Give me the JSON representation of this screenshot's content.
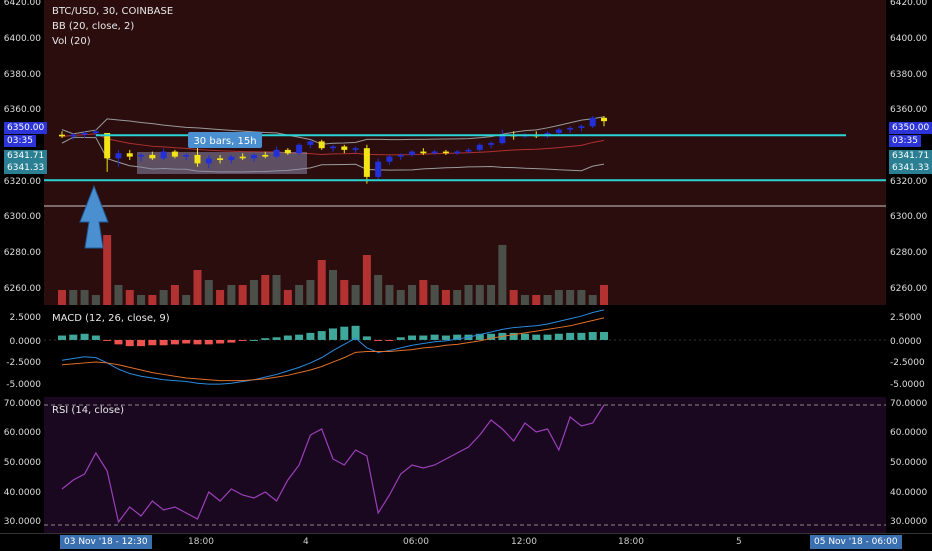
{
  "symbol_title": "BTC/USD, 30, COINBASE",
  "indicators": {
    "bb": "BB (20, close, 2)",
    "vol": "Vol (20)",
    "macd": "MACD (12, 26, close, 9)",
    "rsi": "RSI (14, close)"
  },
  "price_axis": {
    "ticks": [
      "6420.00",
      "6400.00",
      "6380.00",
      "6360.00",
      "6320.00",
      "6300.00",
      "6280.00",
      "6260.00"
    ],
    "labels": {
      "last": "6350.00",
      "countdown": "03:35",
      "line_high": "6341.71",
      "line_low": "6341.33"
    }
  },
  "macd_axis": {
    "ticks": [
      "2.5000",
      "0.0000",
      "-2.5000",
      "-5.0000"
    ]
  },
  "rsi_axis": {
    "ticks": [
      "70.0000",
      "60.0000",
      "50.0000",
      "40.0000",
      "30.0000"
    ]
  },
  "time_axis": {
    "start_box": "03 Nov '18 - 12:30",
    "ticks": [
      "18:00",
      "4",
      "06:00",
      "12:00",
      "18:00",
      "5"
    ],
    "end_box": "05 Nov '18 - 06:00"
  },
  "measure_label": "30 bars, 15h",
  "colors": {
    "up_candle": "#2130d8",
    "down_candle": "#f2e416",
    "horizontal_lines": "#2ad3d6",
    "bollinger": "#9a9a9a",
    "vol_up": "#4a4f4a",
    "vol_down": "#b23232",
    "macd_line": "#2a8be0",
    "signal_line": "#e0702a",
    "hist_pos": "#3fa89a",
    "hist_neg": "#ef5350",
    "rsi_line": "#9b3fb8",
    "arrow": "#4a8fd0"
  },
  "chart_data": [
    {
      "type": "candlestick",
      "title": "BTC/USD, 30, COINBASE",
      "candles": [
        {
          "o": 6342,
          "h": 6344,
          "l": 6340,
          "c": 6341
        },
        {
          "o": 6341,
          "h": 6343,
          "l": 6339,
          "c": 6342
        },
        {
          "o": 6342,
          "h": 6344,
          "l": 6340,
          "c": 6343
        },
        {
          "o": 6343,
          "h": 6345,
          "l": 6341,
          "c": 6344
        },
        {
          "o": 6343,
          "h": 6343,
          "l": 6320,
          "c": 6328
        },
        {
          "o": 6328,
          "h": 6333,
          "l": 6323,
          "c": 6331
        },
        {
          "o": 6331,
          "h": 6333,
          "l": 6327,
          "c": 6329
        },
        {
          "o": 6329,
          "h": 6331,
          "l": 6326,
          "c": 6330
        },
        {
          "o": 6330,
          "h": 6332,
          "l": 6327,
          "c": 6328
        },
        {
          "o": 6328,
          "h": 6334,
          "l": 6327,
          "c": 6332
        },
        {
          "o": 6332,
          "h": 6333,
          "l": 6328,
          "c": 6329
        },
        {
          "o": 6329,
          "h": 6331,
          "l": 6327,
          "c": 6330
        },
        {
          "o": 6330,
          "h": 6338,
          "l": 6323,
          "c": 6325
        },
        {
          "o": 6325,
          "h": 6330,
          "l": 6322,
          "c": 6328
        },
        {
          "o": 6328,
          "h": 6330,
          "l": 6325,
          "c": 6327
        },
        {
          "o": 6327,
          "h": 6330,
          "l": 6325,
          "c": 6329
        },
        {
          "o": 6329,
          "h": 6331,
          "l": 6327,
          "c": 6328
        },
        {
          "o": 6328,
          "h": 6331,
          "l": 6326,
          "c": 6330
        },
        {
          "o": 6330,
          "h": 6332,
          "l": 6328,
          "c": 6329
        },
        {
          "o": 6329,
          "h": 6335,
          "l": 6328,
          "c": 6333
        },
        {
          "o": 6333,
          "h": 6334,
          "l": 6330,
          "c": 6331
        },
        {
          "o": 6331,
          "h": 6337,
          "l": 6330,
          "c": 6336
        },
        {
          "o": 6336,
          "h": 6339,
          "l": 6334,
          "c": 6338
        },
        {
          "o": 6338,
          "h": 6339,
          "l": 6333,
          "c": 6334
        },
        {
          "o": 6334,
          "h": 6336,
          "l": 6332,
          "c": 6335
        },
        {
          "o": 6335,
          "h": 6336,
          "l": 6331,
          "c": 6333
        },
        {
          "o": 6333,
          "h": 6335,
          "l": 6331,
          "c": 6334
        },
        {
          "o": 6334,
          "h": 6336,
          "l": 6313,
          "c": 6317
        },
        {
          "o": 6317,
          "h": 6328,
          "l": 6315,
          "c": 6326
        },
        {
          "o": 6326,
          "h": 6330,
          "l": 6324,
          "c": 6329
        },
        {
          "o": 6329,
          "h": 6331,
          "l": 6327,
          "c": 6330
        },
        {
          "o": 6330,
          "h": 6333,
          "l": 6329,
          "c": 6332
        },
        {
          "o": 6332,
          "h": 6334,
          "l": 6330,
          "c": 6331
        },
        {
          "o": 6331,
          "h": 6333,
          "l": 6330,
          "c": 6332
        },
        {
          "o": 6332,
          "h": 6333,
          "l": 6330,
          "c": 6331
        },
        {
          "o": 6331,
          "h": 6333,
          "l": 6330,
          "c": 6332
        },
        {
          "o": 6332,
          "h": 6334,
          "l": 6331,
          "c": 6333
        },
        {
          "o": 6333,
          "h": 6337,
          "l": 6332,
          "c": 6336
        },
        {
          "o": 6336,
          "h": 6338,
          "l": 6334,
          "c": 6337
        },
        {
          "o": 6337,
          "h": 6345,
          "l": 6336,
          "c": 6342
        },
        {
          "o": 6342,
          "h": 6344,
          "l": 6339,
          "c": 6341
        },
        {
          "o": 6341,
          "h": 6343,
          "l": 6340,
          "c": 6342
        },
        {
          "o": 6342,
          "h": 6344,
          "l": 6340,
          "c": 6341
        },
        {
          "o": 6341,
          "h": 6344,
          "l": 6340,
          "c": 6343
        },
        {
          "o": 6343,
          "h": 6346,
          "l": 6342,
          "c": 6345
        },
        {
          "o": 6345,
          "h": 6347,
          "l": 6343,
          "c": 6346
        },
        {
          "o": 6346,
          "h": 6348,
          "l": 6344,
          "c": 6347
        },
        {
          "o": 6347,
          "h": 6353,
          "l": 6346,
          "c": 6352
        },
        {
          "o": 6352,
          "h": 6353,
          "l": 6347,
          "c": 6350
        }
      ],
      "ylim": [
        6250,
        6420
      ],
      "horizontal_lines": [
        6341.7,
        6315
      ],
      "volume": [
        3,
        3,
        3,
        2,
        14,
        4,
        3,
        2,
        2,
        3,
        4,
        2,
        7,
        5,
        3,
        4,
        4,
        5,
        6,
        6,
        3,
        4,
        5,
        9,
        7,
        5,
        4,
        10,
        6,
        4,
        3,
        4,
        5,
        4,
        3,
        3,
        4,
        4,
        4,
        12,
        3,
        2,
        2,
        2,
        3,
        3,
        3,
        2,
        4
      ]
    },
    {
      "type": "line",
      "title": "MACD (12, 26, close, 9)",
      "ylim": [
        -6,
        3.5
      ],
      "series": [
        {
          "name": "MACD",
          "values": [
            -2.3,
            -2.1,
            -1.9,
            -2.0,
            -2.6,
            -3.3,
            -3.8,
            -4.1,
            -4.3,
            -4.5,
            -4.6,
            -4.7,
            -4.9,
            -5.0,
            -5.0,
            -4.9,
            -4.7,
            -4.5,
            -4.2,
            -3.9,
            -3.5,
            -3.1,
            -2.6,
            -2.0,
            -1.2,
            -0.5,
            0.2,
            -0.9,
            -1.4,
            -1.2,
            -0.9,
            -0.6,
            -0.4,
            -0.2,
            -0.1,
            0.1,
            0.3,
            0.6,
            0.9,
            1.2,
            1.4,
            1.5,
            1.6,
            1.8,
            2.1,
            2.4,
            2.7,
            3.1,
            3.4
          ]
        },
        {
          "name": "Signal",
          "values": [
            -2.8,
            -2.7,
            -2.6,
            -2.5,
            -2.6,
            -2.8,
            -3.1,
            -3.4,
            -3.7,
            -3.9,
            -4.1,
            -4.3,
            -4.4,
            -4.5,
            -4.6,
            -4.6,
            -4.6,
            -4.5,
            -4.4,
            -4.2,
            -4.0,
            -3.7,
            -3.4,
            -3.0,
            -2.5,
            -2.0,
            -1.4,
            -1.3,
            -1.3,
            -1.3,
            -1.2,
            -1.1,
            -0.9,
            -0.8,
            -0.6,
            -0.5,
            -0.3,
            -0.1,
            0.2,
            0.4,
            0.6,
            0.8,
            1.0,
            1.2,
            1.4,
            1.6,
            1.9,
            2.2,
            2.5
          ]
        },
        {
          "name": "Histogram",
          "values": [
            0.5,
            0.6,
            0.7,
            0.5,
            -0.1,
            -0.5,
            -0.7,
            -0.7,
            -0.6,
            -0.6,
            -0.5,
            -0.4,
            -0.5,
            -0.5,
            -0.4,
            -0.3,
            -0.1,
            0.0,
            0.2,
            0.3,
            0.5,
            0.6,
            0.8,
            1.0,
            1.3,
            1.5,
            1.6,
            0.4,
            -0.1,
            -0.1,
            0.3,
            0.5,
            0.5,
            0.6,
            0.5,
            0.6,
            0.6,
            0.7,
            0.7,
            0.8,
            0.8,
            0.7,
            0.6,
            0.6,
            0.7,
            0.8,
            0.8,
            0.9,
            0.9
          ]
        }
      ]
    },
    {
      "type": "line",
      "title": "RSI (14, close)",
      "ylim": [
        28,
        72
      ],
      "series": [
        {
          "name": "RSI",
          "values": [
            42,
            45,
            47,
            54,
            48,
            31,
            36,
            33,
            38,
            35,
            36,
            34,
            32,
            41,
            38,
            42,
            40,
            39,
            41,
            38,
            45,
            50,
            60,
            62,
            52,
            50,
            55,
            53,
            34,
            40,
            47,
            50,
            49,
            50,
            52,
            54,
            56,
            60,
            65,
            62,
            58,
            64,
            61,
            62,
            55,
            66,
            63,
            64,
            70
          ]
        }
      ],
      "bands": [
        70,
        30
      ]
    }
  ]
}
